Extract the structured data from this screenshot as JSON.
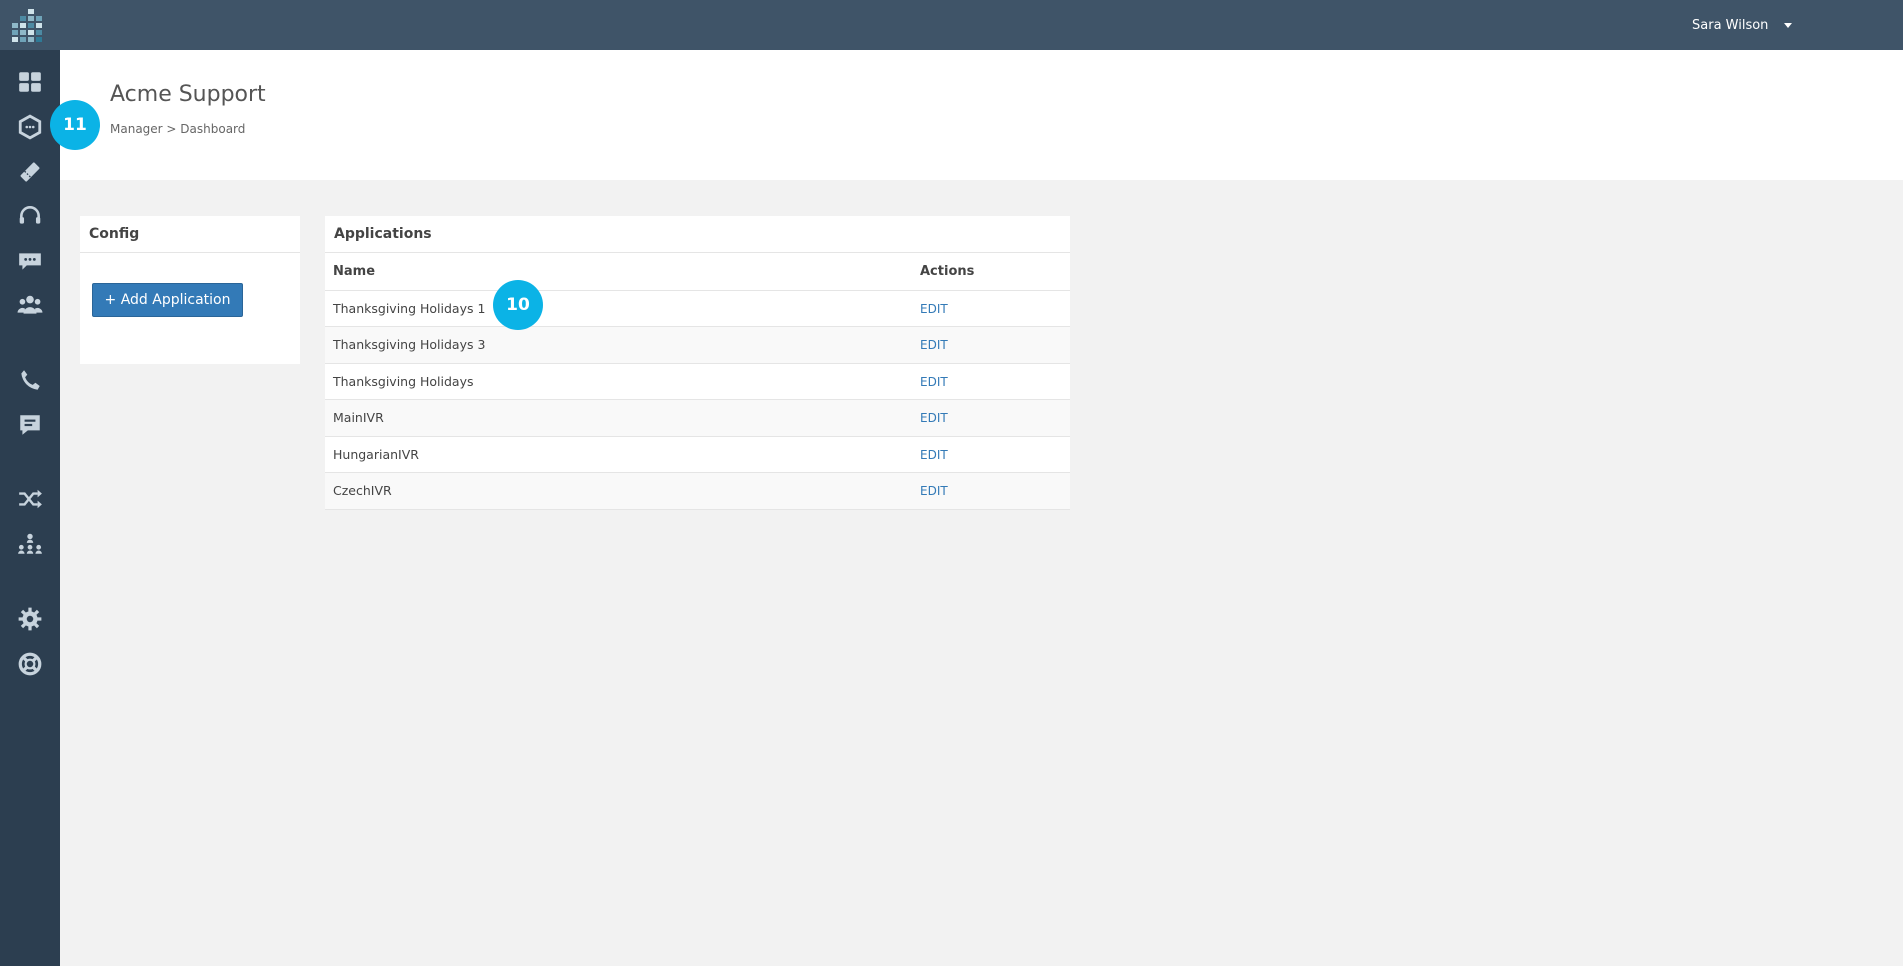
{
  "header": {
    "user_name": "Sara Wilson"
  },
  "sidebar": {
    "items": [
      {
        "icon": "dashboard-icon"
      },
      {
        "icon": "hexagon-icon"
      },
      {
        "icon": "ticket-icon"
      },
      {
        "icon": "headset-icon"
      },
      {
        "icon": "chat-icon"
      },
      {
        "icon": "users-icon"
      },
      {
        "icon": "phone-icon"
      },
      {
        "icon": "message-icon"
      },
      {
        "icon": "shuffle-icon"
      },
      {
        "icon": "org-chart-icon"
      },
      {
        "icon": "gear-icon"
      },
      {
        "icon": "support-icon"
      }
    ]
  },
  "page": {
    "title": "Acme Support",
    "breadcrumb": "Manager > Dashboard"
  },
  "badges": {
    "header_badge": "11",
    "row_badge": "10"
  },
  "config_panel": {
    "title": "Config",
    "add_button_label": "+ Add Application"
  },
  "applications_panel": {
    "title": "Applications",
    "columns": {
      "name": "Name",
      "actions": "Actions"
    },
    "rows": [
      {
        "name": "Thanksgiving Holidays 1",
        "action": "EDIT"
      },
      {
        "name": "Thanksgiving Holidays 3",
        "action": "EDIT"
      },
      {
        "name": "Thanksgiving Holidays",
        "action": "EDIT"
      },
      {
        "name": "MainIVR",
        "action": "EDIT"
      },
      {
        "name": "HungarianIVR",
        "action": "EDIT"
      },
      {
        "name": "CzechIVR",
        "action": "EDIT"
      }
    ]
  },
  "colors": {
    "topbar": "#3f5468",
    "sidebar": "#2c3e50",
    "accent_button": "#337ab7",
    "badge": "#0bb3e6"
  }
}
